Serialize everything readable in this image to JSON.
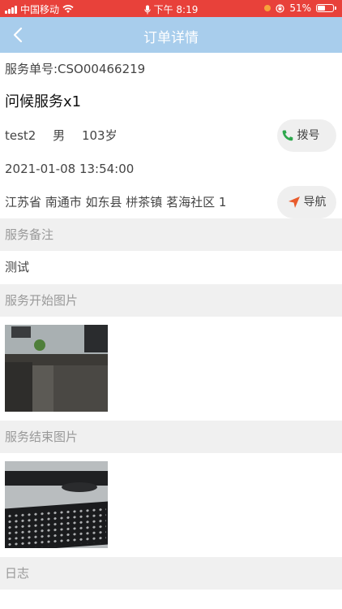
{
  "status_bar": {
    "carrier": "中国移动",
    "time": "下午 8:19",
    "battery": "51%",
    "battery_level": 0.51
  },
  "nav": {
    "title": "订单详情",
    "back_icon": "chevron-left-icon"
  },
  "order": {
    "order_no": "服务单号:CSO00466219",
    "service_name": "问候服务x1",
    "name": "test2",
    "gender": "男",
    "age": "103岁",
    "datetime": "2021-01-08 13:54:00",
    "address": "江苏省 南通市 如东县 栟茶镇 茗海社区 1"
  },
  "buttons": {
    "call_label": "拨号",
    "call_icon": "phone-icon",
    "navigate_label": "导航",
    "navigate_icon": "navigation-arrow-icon"
  },
  "sections": {
    "remark_header": "服务备注",
    "remark_text": "测试",
    "start_photo_header": "服务开始图片",
    "end_photo_header": "服务结束图片",
    "log_header": "日志"
  },
  "colors": {
    "status_bar": "#e8413a",
    "nav_bar": "#a8cdec",
    "phone_green": "#2ea84d",
    "nav_orange": "#e85b2c"
  }
}
